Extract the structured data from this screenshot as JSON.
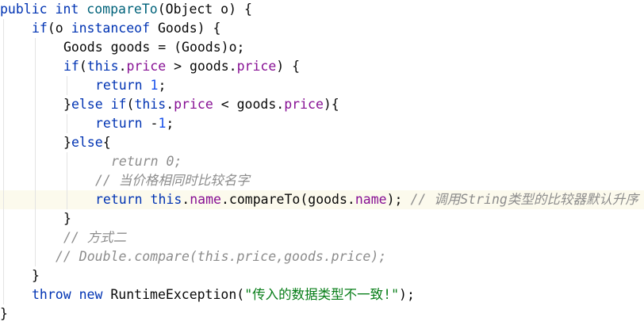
{
  "editor": {
    "highlighted_line": 10,
    "lines": [
      {
        "indent": 0,
        "tokens": [
          [
            "kw",
            "public"
          ],
          [
            "txt",
            " "
          ],
          [
            "kw",
            "int"
          ],
          [
            "txt",
            " "
          ],
          [
            "m",
            "compareTo"
          ],
          [
            "txt",
            "(Object o) {"
          ]
        ]
      },
      {
        "indent": 1,
        "tokens": [
          [
            "kw",
            "if"
          ],
          [
            "txt",
            "(o "
          ],
          [
            "kw",
            "instanceof"
          ],
          [
            "txt",
            " Goods) {"
          ]
        ]
      },
      {
        "indent": 2,
        "tokens": [
          [
            "txt",
            "Goods goods = (Goods)o;"
          ]
        ]
      },
      {
        "indent": 2,
        "tokens": [
          [
            "kw",
            "if"
          ],
          [
            "txt",
            "("
          ],
          [
            "kw",
            "this"
          ],
          [
            "txt",
            "."
          ],
          [
            "fd",
            "price"
          ],
          [
            "txt",
            " > goods."
          ],
          [
            "fd",
            "price"
          ],
          [
            "txt",
            ") {"
          ]
        ]
      },
      {
        "indent": 3,
        "tokens": [
          [
            "kw",
            "return"
          ],
          [
            "txt",
            " "
          ],
          [
            "nm",
            "1"
          ],
          [
            "txt",
            ";"
          ]
        ]
      },
      {
        "indent": 2,
        "tokens": [
          [
            "txt",
            "}"
          ],
          [
            "kw",
            "else"
          ],
          [
            "txt",
            " "
          ],
          [
            "kw",
            "if"
          ],
          [
            "txt",
            "("
          ],
          [
            "kw",
            "this"
          ],
          [
            "txt",
            "."
          ],
          [
            "fd",
            "price"
          ],
          [
            "txt",
            " < goods."
          ],
          [
            "fd",
            "price"
          ],
          [
            "txt",
            "){"
          ]
        ]
      },
      {
        "indent": 3,
        "tokens": [
          [
            "kw",
            "return"
          ],
          [
            "txt",
            " -"
          ],
          [
            "nm",
            "1"
          ],
          [
            "txt",
            ";"
          ]
        ]
      },
      {
        "indent": 2,
        "tokens": [
          [
            "txt",
            "}"
          ],
          [
            "kw",
            "else"
          ],
          [
            "txt",
            "{"
          ]
        ]
      },
      {
        "indent": 3.5,
        "tokens": [
          [
            "cm",
            "return 0;"
          ]
        ]
      },
      {
        "indent": 3,
        "tokens": [
          [
            "cm",
            "// 当价格相同时比较名字"
          ]
        ]
      },
      {
        "indent": 3,
        "tokens": [
          [
            "kw",
            "return"
          ],
          [
            "txt",
            " "
          ],
          [
            "kw",
            "this"
          ],
          [
            "txt",
            "."
          ],
          [
            "fd",
            "name"
          ],
          [
            "txt",
            ".compareTo(goods."
          ],
          [
            "fd",
            "name"
          ],
          [
            "txt",
            "); "
          ],
          [
            "cm",
            "// 调用String类型的比较器默认升序"
          ]
        ]
      },
      {
        "indent": 2,
        "tokens": [
          [
            "txt",
            "}"
          ]
        ]
      },
      {
        "indent": 2,
        "tokens": [
          [
            "cm",
            "// 方式二"
          ]
        ]
      },
      {
        "indent": 1.75,
        "tokens": [
          [
            "cm",
            "// Double.compare(this.price,goods.price);"
          ]
        ]
      },
      {
        "indent": 1,
        "tokens": [
          [
            "txt",
            "}"
          ]
        ]
      },
      {
        "indent": 1,
        "tokens": [
          [
            "kw",
            "throw"
          ],
          [
            "txt",
            " "
          ],
          [
            "kw",
            "new"
          ],
          [
            "txt",
            " RuntimeException("
          ],
          [
            "st",
            "\"传入的数据类型不一致!\""
          ],
          [
            "txt",
            ");"
          ]
        ]
      },
      {
        "indent": 0,
        "tokens": [
          [
            "txt",
            "}"
          ]
        ]
      }
    ]
  }
}
